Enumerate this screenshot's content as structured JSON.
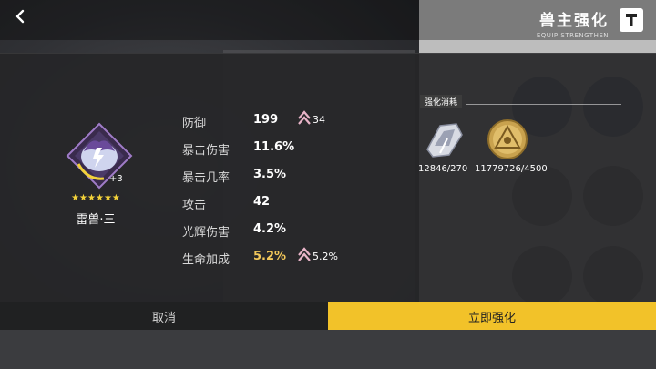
{
  "header": {
    "title": "兽主强化",
    "subtitle": "EQUIP STRENGTHEN",
    "back_icon": "back-arrow-icon",
    "title_icon": "hammer-icon"
  },
  "item": {
    "name": "雷兽·三",
    "level": "+3",
    "stars": "★★★★★★",
    "icon": "thunder-beast-icon"
  },
  "stats": [
    {
      "label": "防御",
      "value": "199",
      "increase": "34"
    },
    {
      "label": "暴击伤害",
      "value": "11.6%"
    },
    {
      "label": "暴击几率",
      "value": "3.5%"
    },
    {
      "label": "攻击",
      "value": "42"
    },
    {
      "label": "光辉伤害",
      "value": "4.2%"
    },
    {
      "label": "生命加成",
      "value": "5.2%",
      "increase": "5.2%"
    }
  ],
  "cost": {
    "label": "强化消耗",
    "items": [
      {
        "icon": "silver-material-icon",
        "value": "12846/270"
      },
      {
        "icon": "gold-coin-icon",
        "value": "11779726/4500"
      }
    ]
  },
  "buttons": {
    "cancel": "取消",
    "confirm": "立即强化"
  },
  "colors": {
    "accent": "#f2c229",
    "highlight_value": "#f3c85a",
    "increase_arrow": "#e8b4c8"
  }
}
